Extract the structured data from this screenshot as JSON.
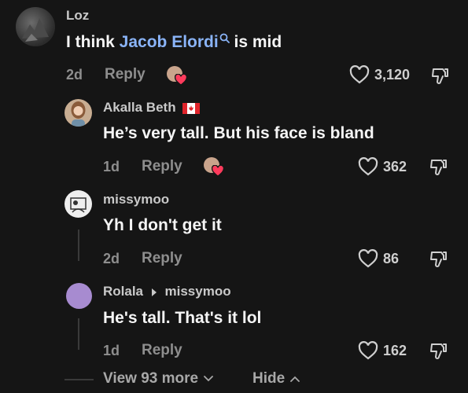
{
  "comments": [
    {
      "author": "Loz",
      "text_before_link": "I think ",
      "link_text": "Jacob Elordi",
      "text_after_link": " is mid",
      "age": "2d",
      "reply_label": "Reply",
      "likes": "3,120"
    },
    {
      "author": "Akalla Beth",
      "flag_icon": "canada-flag-icon",
      "text": "He’s very tall. But his face is bland",
      "age": "1d",
      "reply_label": "Reply",
      "likes": "362"
    },
    {
      "author": "missymoo",
      "text": "Yh I don't get it",
      "age": "2d",
      "reply_label": "Reply",
      "likes": "86"
    },
    {
      "author": "Rolala",
      "reply_to": "missymoo",
      "text": "He's tall. That's it lol",
      "age": "1d",
      "reply_label": "Reply",
      "likes": "162"
    }
  ],
  "footer": {
    "view_more": "View 93 more",
    "hide": "Hide"
  },
  "colors": {
    "background": "#151515",
    "link": "#8ab4f8",
    "rolala_avatar": "#a78bd0",
    "heart_red": "#ff3b5c"
  }
}
